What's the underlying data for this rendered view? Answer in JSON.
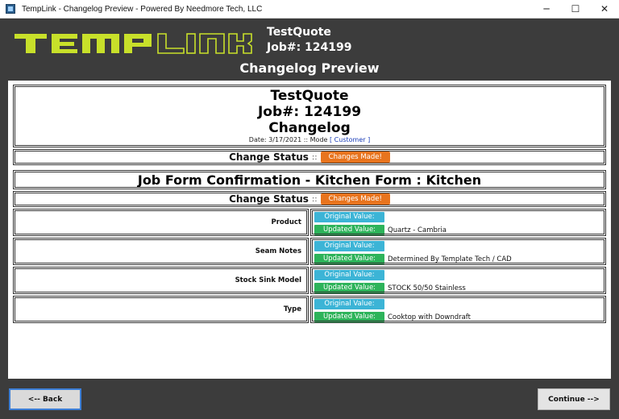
{
  "window": {
    "title": "TempLink - Changelog Preview - Powered By Needmore Tech, LLC",
    "controls": [
      "─",
      "☐",
      "✕"
    ]
  },
  "header": {
    "logo_text": "TEMPLINK",
    "logo_color": "#c8e02a",
    "quote_name": "TestQuote",
    "job_number": "Job#: 124199",
    "page_title": "Changelog Preview"
  },
  "document": {
    "quote_name": "TestQuote",
    "job_number": "Job#: 124199",
    "heading": "Changelog",
    "date_text": "Date: 3/17/2021 :: Mode",
    "mode_text": "[ Customer ]",
    "change_status_label": "Change Status",
    "change_status_sep": "::",
    "change_status_value": "Changes Made!",
    "form_title": "Job Form Confirmation - Kitchen Form : Kitchen",
    "form_status_label": "Change Status",
    "form_status_sep": "::",
    "form_status_value": "Changes Made!",
    "original_label": "Original Value:",
    "updated_label": "Updated Value:",
    "fields": [
      {
        "name": "Product",
        "original": "",
        "updated": "Quartz - Cambria"
      },
      {
        "name": "Seam Notes",
        "original": "",
        "updated": "Determined By Template Tech / CAD"
      },
      {
        "name": "Stock Sink Model",
        "original": "",
        "updated": "STOCK 50/50 Stainless"
      },
      {
        "name": "Type",
        "original": "",
        "updated": "Cooktop with Downdraft"
      }
    ]
  },
  "footer": {
    "back_label": "<-- Back",
    "continue_label": "Continue -->"
  }
}
